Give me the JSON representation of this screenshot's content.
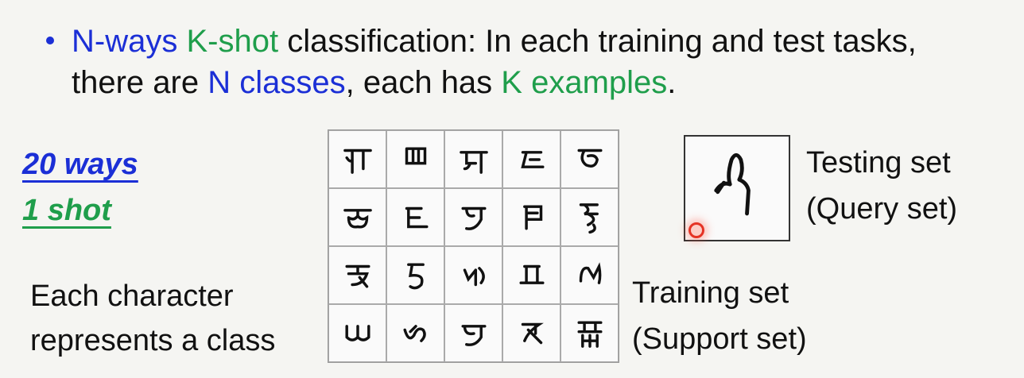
{
  "bullet": {
    "line1": {
      "n_ways": "N-ways",
      "k_shot": "K-shot",
      "rest": " classification: In each training and test tasks,"
    },
    "line2": {
      "prefix": "there are ",
      "n_classes": "N classes",
      "middle": ", each has ",
      "k_examples": "K examples",
      "suffix": "."
    }
  },
  "ways_label": "20 ways",
  "shot_label": "1 shot",
  "caption_left": [
    "Each character",
    "represents a class"
  ],
  "training_label": [
    "Training set",
    "(Support set)"
  ],
  "testing_label": [
    "Testing set",
    "(Query set)"
  ],
  "colors": {
    "blue": "#1b2fd6",
    "green": "#1f9e4b",
    "cursor": "#e53224"
  },
  "grid": {
    "rows": 4,
    "cols": 5,
    "content": "handwritten-character-icon"
  }
}
